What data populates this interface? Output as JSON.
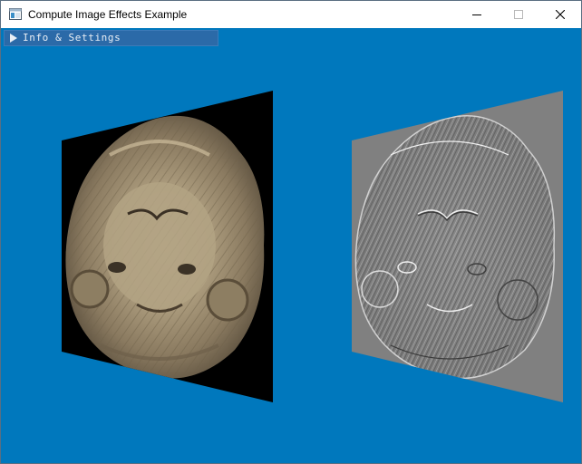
{
  "window": {
    "title": "Compute Image Effects Example",
    "icon": "app-window-icon",
    "controls": [
      "minimize-icon",
      "maximize-icon",
      "close-icon"
    ]
  },
  "overlay": {
    "panel_title": "Info & Settings",
    "expanded": false,
    "arrow_icon": "triangle-right-icon"
  },
  "scene": {
    "background_color": "#0078bd",
    "left_quad_label": "original lion relief texture",
    "right_quad_label": "edge-detect / emboss compute shader result"
  },
  "colors": {
    "accent": "#0078bd",
    "panel_bg": "#2b6aa8",
    "left_quad_bg": "#000000",
    "right_quad_bg": "#808080"
  }
}
